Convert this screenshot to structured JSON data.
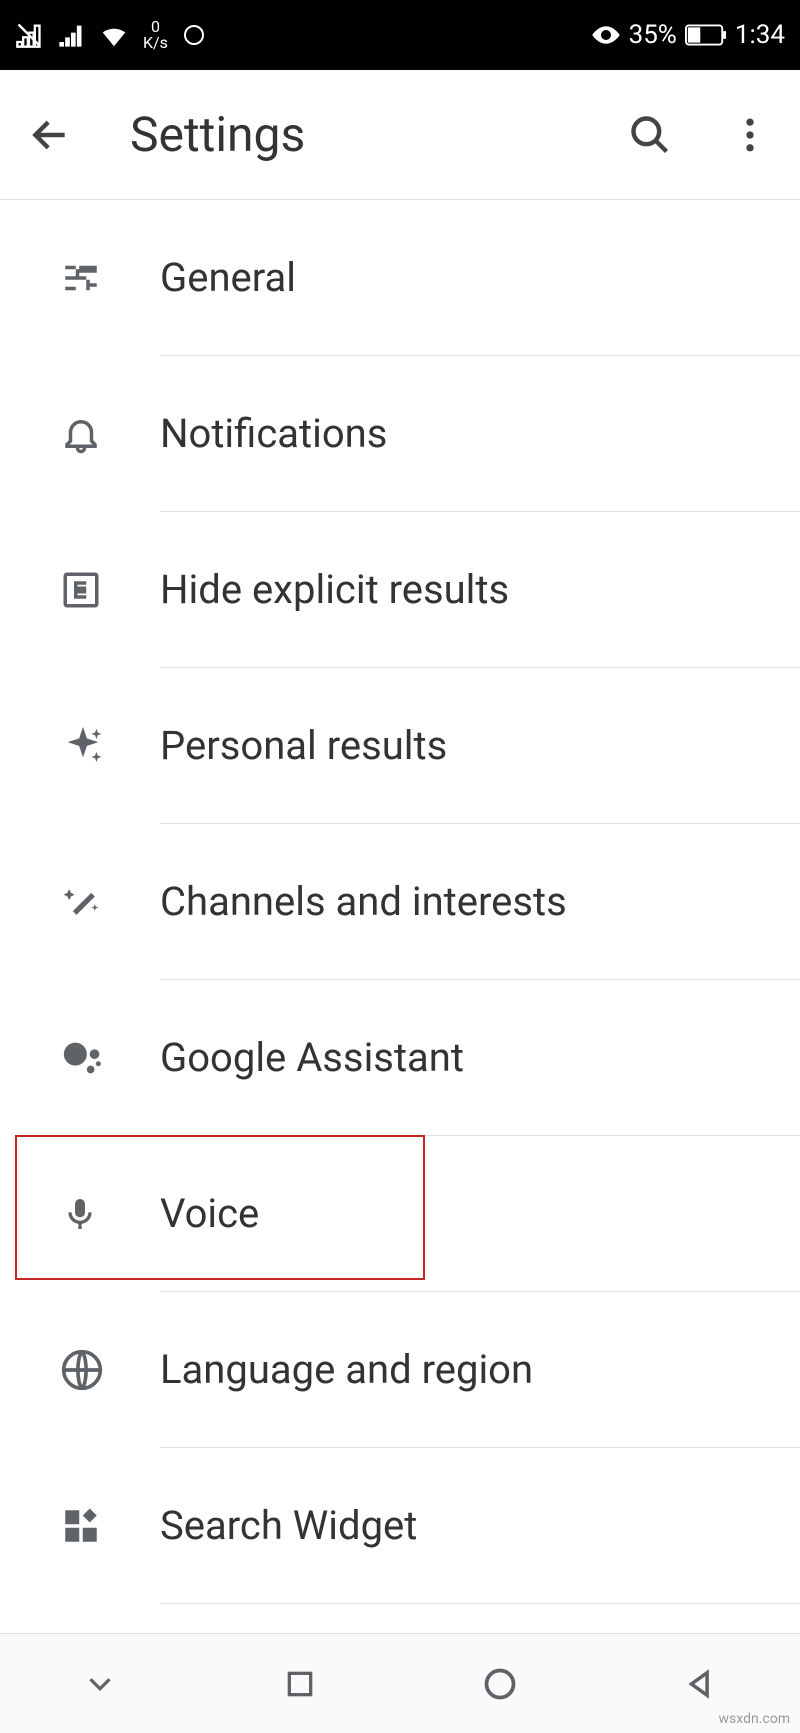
{
  "status": {
    "speed_top": "0",
    "speed_bot": "K/s",
    "battery_pct": "35%",
    "time": "1:34"
  },
  "header": {
    "title": "Settings"
  },
  "items": [
    {
      "icon": "sliders-icon",
      "label": "General"
    },
    {
      "icon": "bell-icon",
      "label": "Notifications"
    },
    {
      "icon": "explicit-icon",
      "label": "Hide explicit results"
    },
    {
      "icon": "sparkle-icon",
      "label": "Personal results"
    },
    {
      "icon": "wand-icon",
      "label": "Channels and interests"
    },
    {
      "icon": "assistant-icon",
      "label": "Google Assistant"
    },
    {
      "icon": "mic-icon",
      "label": "Voice"
    },
    {
      "icon": "globe-icon",
      "label": "Language and region"
    },
    {
      "icon": "widget-icon",
      "label": "Search Widget"
    }
  ],
  "highlight": {
    "visible": true,
    "item_index": 6
  },
  "watermark": "wsxdn.com"
}
